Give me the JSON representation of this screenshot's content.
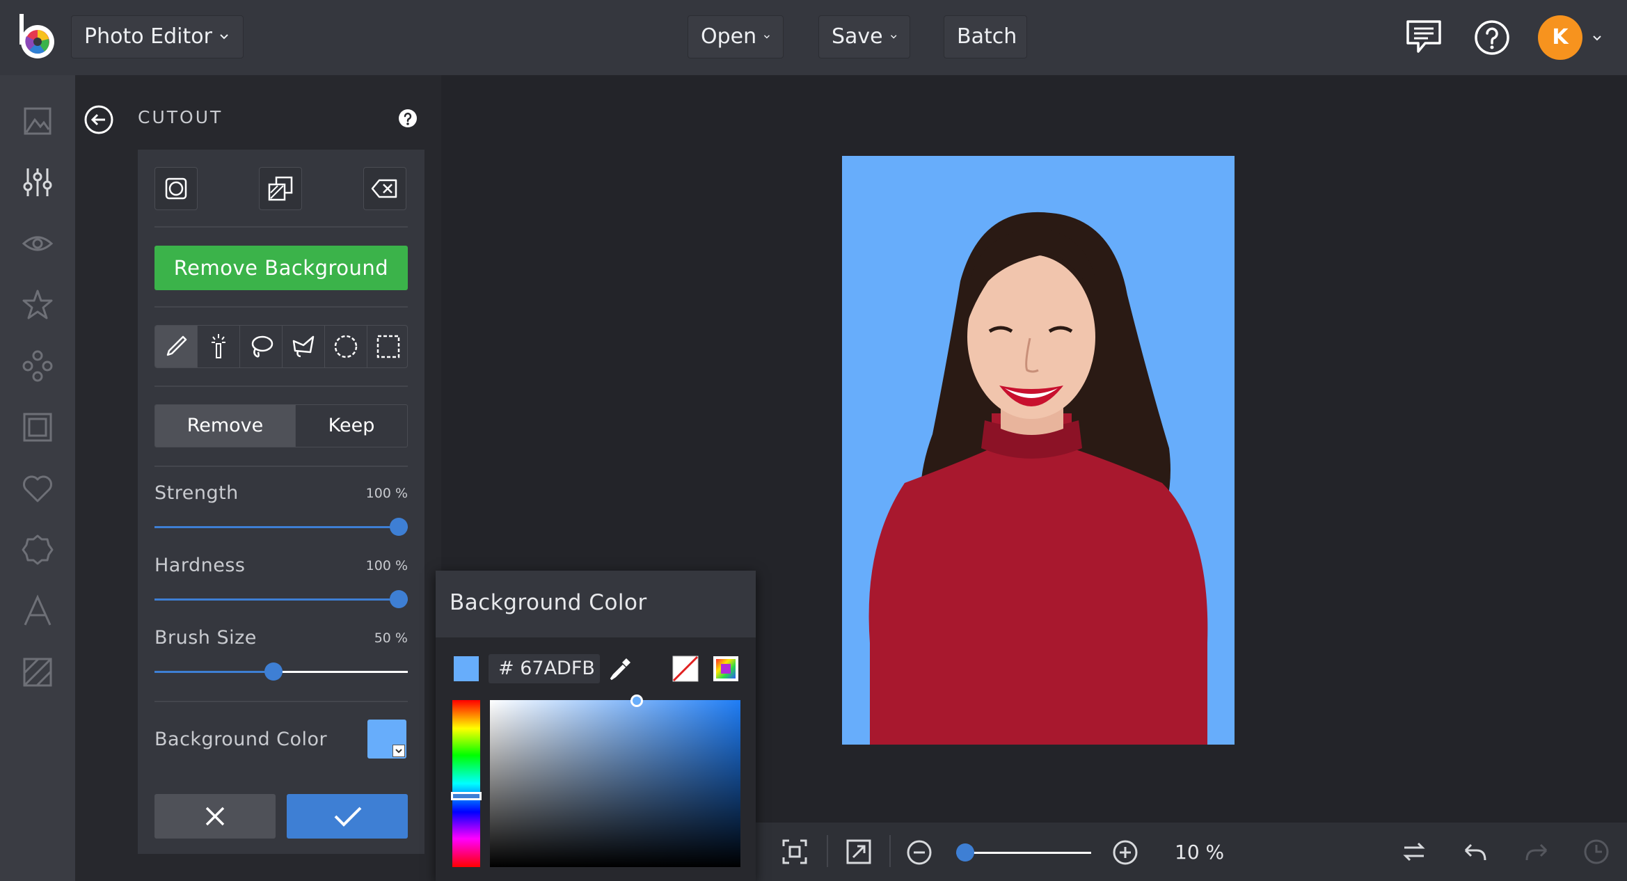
{
  "topbar": {
    "app_menu_label": "Photo Editor",
    "open_label": "Open",
    "save_label": "Save",
    "batch_label": "Batch",
    "avatar_initial": "K",
    "avatar_color": "#f7931e"
  },
  "rail": {
    "icons": [
      "image-icon",
      "sliders-icon",
      "eye-icon",
      "star-icon",
      "overlays-icon",
      "frame-icon",
      "heart-icon",
      "badge-icon",
      "text-icon",
      "texture-icon"
    ]
  },
  "panel": {
    "title": "CUTOUT",
    "remove_bg_label": "Remove Background",
    "mode_remove": "Remove",
    "mode_keep": "Keep",
    "strength_label": "Strength",
    "strength_value": "100 %",
    "strength_level": 1.0,
    "hardness_label": "Hardness",
    "hardness_value": "100 %",
    "hardness_level": 1.0,
    "brush_label": "Brush Size",
    "brush_value": "50 %",
    "brush_level": 0.47,
    "bgcolor_label": "Background Color",
    "bgcolor": "#67ADFB",
    "accent_green": "#3bb34a",
    "accent_blue": "#3e7fd4"
  },
  "popover": {
    "title": "Background Color",
    "hex_prefix": "#",
    "hex_value": "67ADFB"
  },
  "bottom": {
    "zoom_label": "10 %",
    "zoom_level": 0.06
  }
}
